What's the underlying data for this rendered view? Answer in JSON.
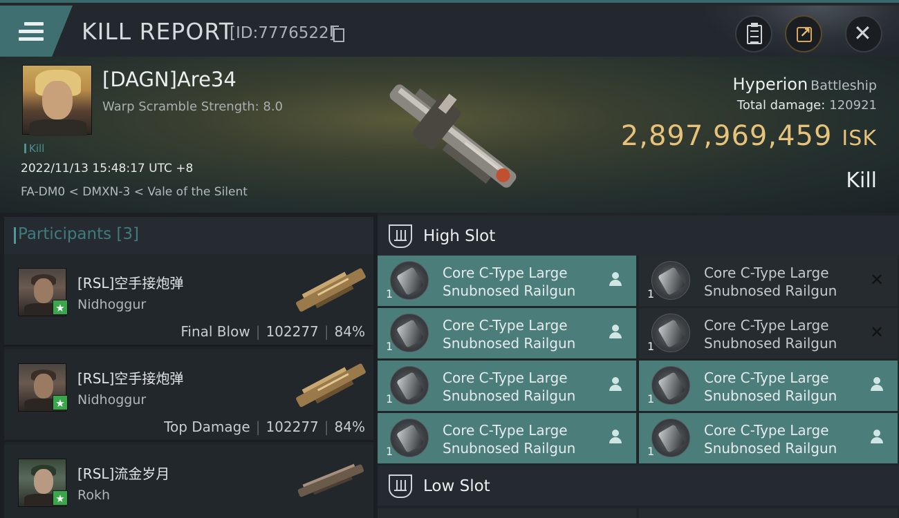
{
  "header": {
    "title": "KILL REPORT",
    "report_id": "[ID:7776522]"
  },
  "victim": {
    "name": "[DAGN]Are34",
    "warp_scramble": "Warp Scramble Strength: 8.0",
    "tag": "Kill",
    "datetime": "2022/11/13 15:48:17 UTC +8",
    "location": "FA-DM0 < DMXN-3 < Vale of the Silent",
    "ship_name": "Hyperion",
    "ship_class": "Battleship",
    "total_damage_label": "Total damage:",
    "total_damage": "120921",
    "isk_value": "2,897,969,459",
    "isk_unit": "ISK",
    "result": "Kill"
  },
  "participants": {
    "title": "Participants [3]",
    "items": [
      {
        "corp_name": "[RSL]空手接炮弹",
        "ship": "Nidhoggur",
        "role": "Final Blow",
        "damage": "102277",
        "percent": "84%"
      },
      {
        "corp_name": "[RSL]空手接炮弹",
        "ship": "Nidhoggur",
        "role": "Top Damage",
        "damage": "102277",
        "percent": "84%"
      },
      {
        "corp_name": "[RSL]流金岁月",
        "ship": "Rokh"
      }
    ]
  },
  "high_slot": {
    "label": "High Slot",
    "modules": [
      {
        "name": "Core C-Type Large Snubnosed Railgun",
        "qty": "1",
        "status": "active"
      },
      {
        "name": "Core C-Type Large Snubnosed Railgun",
        "qty": "1",
        "status": "destroyed"
      },
      {
        "name": "Core C-Type Large Snubnosed Railgun",
        "qty": "1",
        "status": "active"
      },
      {
        "name": "Core C-Type Large Snubnosed Railgun",
        "qty": "1",
        "status": "destroyed"
      },
      {
        "name": "Core C-Type Large Snubnosed Railgun",
        "qty": "1",
        "status": "active"
      },
      {
        "name": "Core C-Type Large Snubnosed Railgun",
        "qty": "1",
        "status": "active"
      },
      {
        "name": "Core C-Type Large Snubnosed Railgun",
        "qty": "1",
        "status": "active"
      },
      {
        "name": "Core C-Type Large Snubnosed Railgun",
        "qty": "1",
        "status": "active"
      }
    ]
  },
  "low_slot": {
    "label": "Low Slot"
  },
  "icons": {
    "menu": "hamburger-icon",
    "copy": "copy-icon",
    "clipboard": "clipboard-icon",
    "share": "share-icon",
    "close": "close-icon",
    "slot": "slot-icon",
    "pilot": "person-icon",
    "destroyed": "x-icon"
  },
  "colors": {
    "accent": "#4b7e7b",
    "isk": "#e6c27a",
    "badge": "#3aa84a"
  }
}
